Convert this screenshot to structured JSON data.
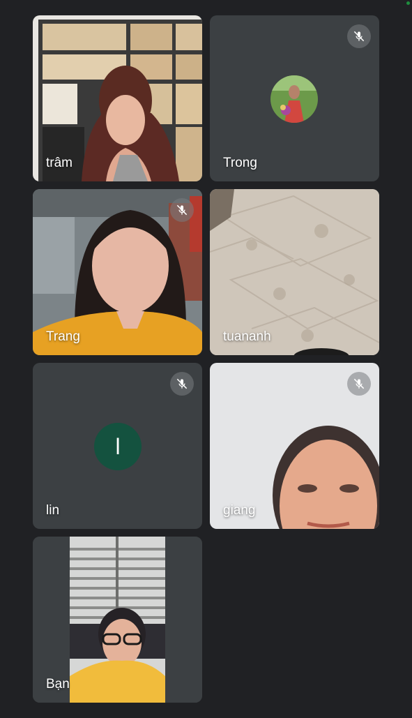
{
  "participants": [
    {
      "name": "trâm",
      "muted": false,
      "view": "video"
    },
    {
      "name": "Trong",
      "muted": true,
      "view": "avatar-photo"
    },
    {
      "name": "Trang",
      "muted": true,
      "view": "video"
    },
    {
      "name": "tuananh",
      "muted": false,
      "view": "video"
    },
    {
      "name": "lin",
      "muted": true,
      "view": "avatar-letter",
      "initial": "l",
      "avatar_color": "#14523f"
    },
    {
      "name": "giang",
      "muted": true,
      "view": "video"
    },
    {
      "name": "Bạn",
      "muted": false,
      "view": "self-video"
    }
  ],
  "icons": {
    "mute": "mic-off-icon"
  },
  "colors": {
    "background": "#202124",
    "tile": "#3c4043",
    "status_dot": "#1e8e3e"
  }
}
